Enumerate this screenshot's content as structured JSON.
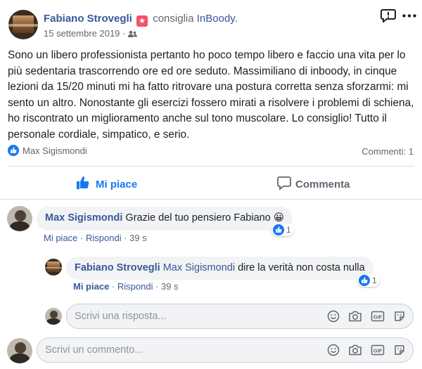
{
  "post": {
    "author": "Fabiano Strovegli",
    "action": "consiglia",
    "page": "InBoody.",
    "date": "15 settembre 2019",
    "body": "Sono un libero professionista pertanto ho poco tempo libero e faccio una vita per lo più sedentaria trascorrendo ore ed ore seduto. Massimiliano di inboody, in cinque lezioni da 15/20 minuti mi ha fatto ritrovare una postura corretta senza sforzarmi: mi sento un altro. Nonostante gli esercizi fossero mirati a risolvere i problemi di schiena, ho riscontrato un miglioramento anche sul tono muscolare. Lo consiglio! Tutto il personale cordiale, simpatico, e serio.",
    "reactor": "Max Sigismondi",
    "comments_count": "Commenti: 1",
    "like_label": "Mi piace",
    "comment_label": "Commenta"
  },
  "comment": {
    "author": "Max Sigismondi",
    "text": "Grazie del tuo pensiero Fabiano",
    "emoji": "😀",
    "reaction_count": "1",
    "like": "Mi piace",
    "reply": "Rispondi",
    "time": "39 s"
  },
  "reply": {
    "author": "Fabiano Strovegli",
    "mention": "Max Sigismondi",
    "text": "dire la verità non costa nulla",
    "reaction_count": "1",
    "like": "Mi piace",
    "reply": "Rispondi",
    "time": "39 s"
  },
  "reply_input": {
    "placeholder": "Scrivi una risposta..."
  },
  "comment_input": {
    "placeholder": "Scrivi un commento..."
  },
  "colors": {
    "brand_blue": "#385898",
    "like_blue": "#1877f2",
    "star_pink": "#f35369"
  },
  "icons": [
    "report-icon",
    "more-icon",
    "friends-icon",
    "like-reaction-icon",
    "thumb-up-icon",
    "comment-icon",
    "emoji-icon",
    "camera-icon",
    "gif-icon",
    "sticker-icon"
  ]
}
